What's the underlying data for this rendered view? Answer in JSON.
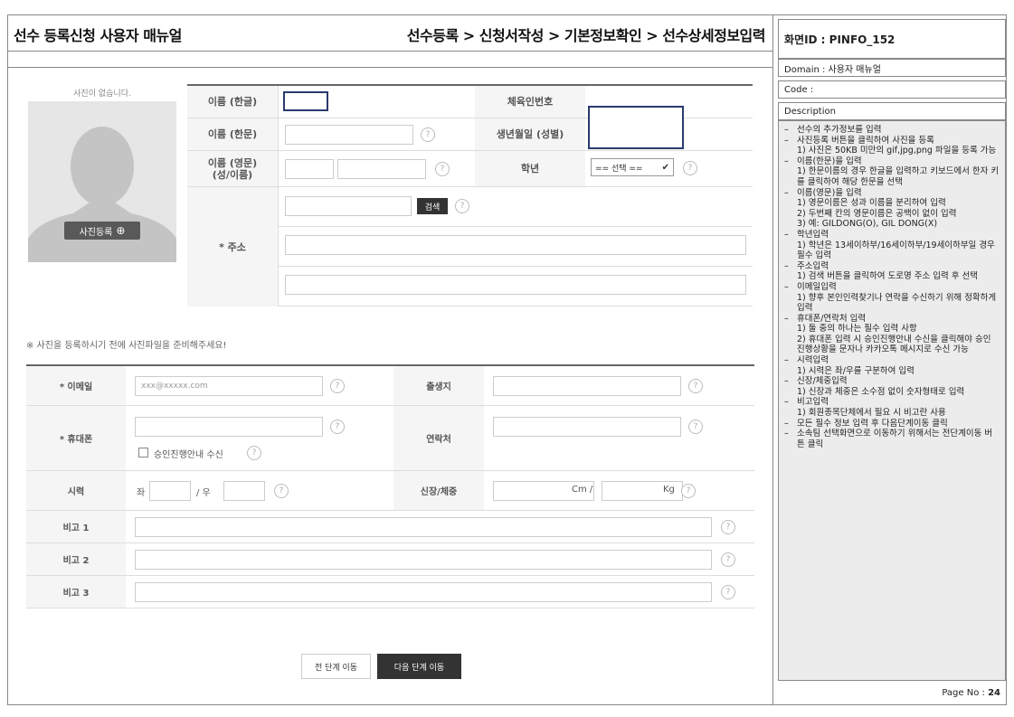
{
  "header": {
    "title": "선수 등록신청 사용자 매뉴얼",
    "breadcrumb": "선수등록 > 신청서작성 > 기본정보확인 > 선수상세정보입력"
  },
  "photo": {
    "no_photo": "사진이 없습니다.",
    "register_button": "사진등록",
    "notice": "※ 사진을 등록하시기 전에 사진파일을 준비해주세요!"
  },
  "basic": {
    "name_kr": "이름 (한글)",
    "sports_id": "체육인번호",
    "name_cn": "이름 (한문)",
    "birth": "생년월일 (성별)",
    "name_en_1": "이름 (영문)",
    "name_en_2": "(성/이름)",
    "grade": "학년",
    "grade_select": "== 선택 ==",
    "address": "* 주소",
    "search_button": "검색"
  },
  "contact": {
    "email": "* 이메일",
    "email_placeholder": "xxx@xxxxx.com",
    "birthplace": "출생지",
    "mobile": "* 휴대폰",
    "sms_check": "승인진행안내 수신",
    "phone": "연락처",
    "eyesight": "시력",
    "left_eye": "좌",
    "right_eye": "/ 우",
    "height_weight": "신장/체중",
    "cm": "Cm /",
    "kg": "Kg",
    "memo1": "비고 1",
    "memo2": "비고 2",
    "memo3": "비고 3"
  },
  "buttons": {
    "prev": "전 단계 이동",
    "next": "다음 단계 이동"
  },
  "help_mark": "?",
  "side": {
    "screen_id": "화면ID : PINFO_152",
    "domain": "Domain : 사용자 매뉴얼",
    "code": "Code :",
    "description_label": "Description",
    "page_label": "Page No :",
    "page_number": "24",
    "desc": [
      {
        "t": "선수의 추가정보를 입력",
        "s": []
      },
      {
        "t": "사진등록 버튼을 클릭하여 사진을 등록",
        "s": [
          "1) 사진은 50KB 미만의 gif,jpg,png 파일을 등록 가능"
        ]
      },
      {
        "t": "이름(한문)을 입력",
        "s": [
          "1) 한문이름의 경우 한글을 입력하고 키보드에서 한자 키를 클릭하여 해당 한문을 선택"
        ]
      },
      {
        "t": "이름(영문)을 입력",
        "s": [
          "1) 영문이름은 성과 이름을 분리하여 입력",
          "2) 두번째 칸의 영문이름은 공백이 없이 입력",
          "3) 예: GILDONG(O), GIL DONG(X)"
        ]
      },
      {
        "t": "학년입력",
        "s": [
          "1) 학년은 13세이하부/16세이하부/19세이하부일 경우 필수 입력"
        ]
      },
      {
        "t": "주소입력",
        "s": [
          "1) 검색 버튼을 클릭하여 도로명 주소 입력 후 선택"
        ]
      },
      {
        "t": "이메일입력",
        "s": [
          "1) 향후 본인인력찾기나 연락을 수신하기 위해 정확하게 입력"
        ]
      },
      {
        "t": "휴대폰/연락처 입력",
        "s": [
          "1) 둘 중의 하나는 필수 입력 사항",
          "2) 휴대폰 입력 시 승인진행안내 수신을 클릭해야 승인 진행상황을 문자나 카카오톡 메시지로 수신 가능"
        ]
      },
      {
        "t": "시력입력",
        "s": [
          "1) 시력은 좌/우를 구분하여 입력"
        ]
      },
      {
        "t": "신장/체중입력",
        "s": [
          "1) 신장과 체중은 소수점 없이 숫자형태로 입력"
        ]
      },
      {
        "t": "비고입력",
        "s": [
          "1) 회원종목단체에서 필요 시 비고란 사용"
        ]
      },
      {
        "t": "모든 필수 정보 입력 후 다음단계이동 클릭",
        "s": []
      },
      {
        "t": "소속팀 선택화면으로 이동하기 위해서는 전단계이동 버튼 클릭",
        "s": []
      }
    ]
  }
}
